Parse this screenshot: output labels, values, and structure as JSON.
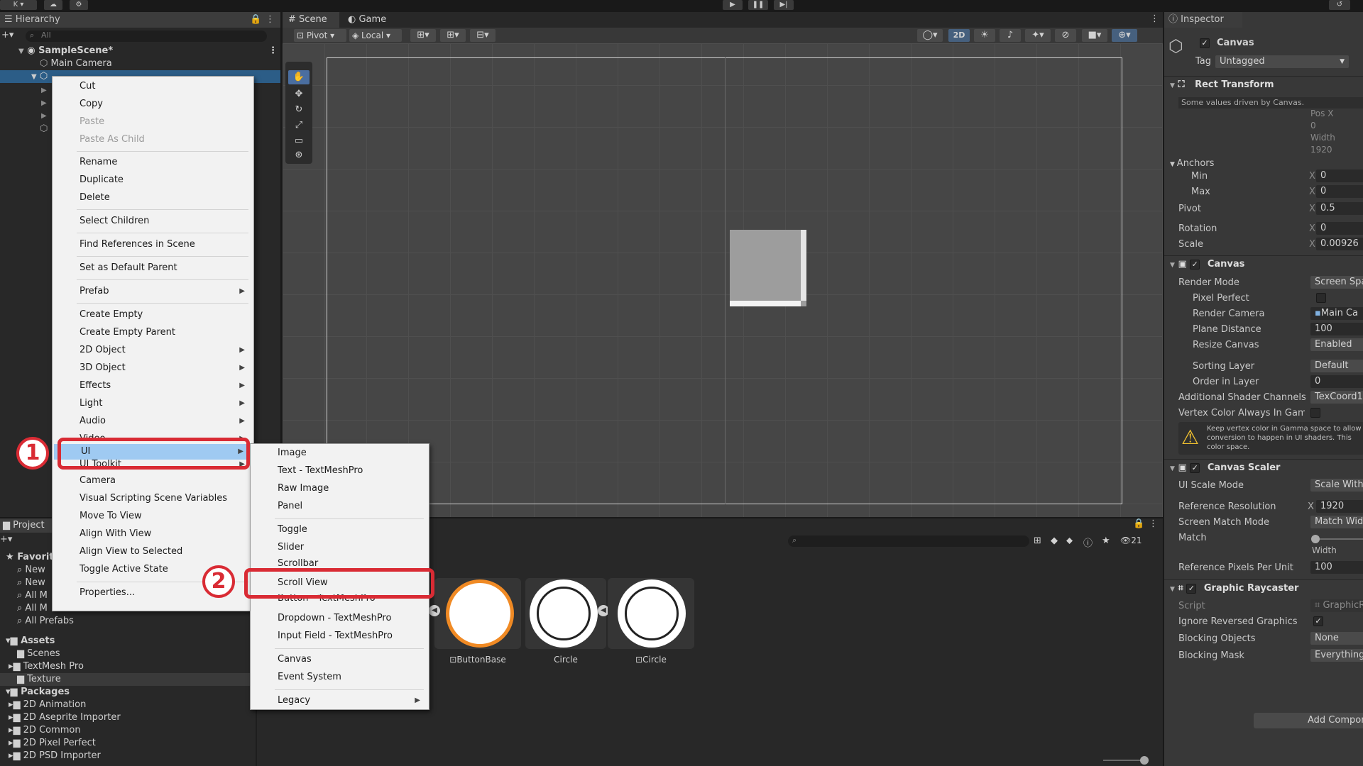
{
  "toolbar": {
    "account_label": "K"
  },
  "hierarchy": {
    "tab_label": "Hierarchy",
    "search_placeholder": "All",
    "scene_name": "SampleScene*",
    "items": [
      "Main Camera"
    ]
  },
  "scene_tabs": {
    "scene": "Scene",
    "game": "Game",
    "pivot": "Pivot",
    "local": "Local",
    "mode_2d": "2D"
  },
  "context_menu": {
    "items": [
      {
        "label": "Cut",
        "enabled": true
      },
      {
        "label": "Copy",
        "enabled": true
      },
      {
        "label": "Paste",
        "enabled": false
      },
      {
        "label": "Paste As Child",
        "enabled": false
      },
      {
        "label": "Rename",
        "enabled": true
      },
      {
        "label": "Duplicate",
        "enabled": true
      },
      {
        "label": "Delete",
        "enabled": true
      },
      {
        "label": "Select Children",
        "enabled": true
      },
      {
        "label": "Find References in Scene",
        "enabled": true
      },
      {
        "label": "Set as Default Parent",
        "enabled": true
      },
      {
        "label": "Prefab",
        "enabled": true
      },
      {
        "label": "Create Empty",
        "enabled": true
      },
      {
        "label": "Create Empty Parent",
        "enabled": true
      },
      {
        "label": "2D Object",
        "enabled": true
      },
      {
        "label": "3D Object",
        "enabled": true
      },
      {
        "label": "Effects",
        "enabled": true
      },
      {
        "label": "Light",
        "enabled": true
      },
      {
        "label": "Audio",
        "enabled": true
      },
      {
        "label": "Video",
        "enabled": true
      },
      {
        "label": "UI",
        "enabled": true
      },
      {
        "label": "UI Toolkit",
        "enabled": true
      },
      {
        "label": "Camera",
        "enabled": true
      },
      {
        "label": "Visual Scripting Scene Variables",
        "enabled": true
      },
      {
        "label": "Move To View",
        "enabled": true
      },
      {
        "label": "Align With View",
        "enabled": true
      },
      {
        "label": "Align View to Selected",
        "enabled": true
      },
      {
        "label": "Toggle Active State",
        "enabled": true
      },
      {
        "label": "Properties...",
        "enabled": true
      }
    ]
  },
  "ui_submenu": {
    "items": [
      "Image",
      "Text - TextMeshPro",
      "Raw Image",
      "Panel",
      "Toggle",
      "Slider",
      "Scrollbar",
      "Scroll View",
      "Button - TextMeshPro",
      "Dropdown - TextMeshPro",
      "Input Field - TextMeshPro",
      "Canvas",
      "Event System",
      "Legacy"
    ]
  },
  "annotations": {
    "step1": "1",
    "step2": "2"
  },
  "project": {
    "tab_label": "Project",
    "favorites_label": "Favorites",
    "favorites": [
      "New",
      "New",
      "All M",
      "All M",
      "All Prefabs"
    ],
    "assets_label": "Assets",
    "assets": [
      "Scenes",
      "TextMesh Pro",
      "Texture"
    ],
    "packages_label": "Packages",
    "packages": [
      "2D Animation",
      "2D Aseprite Importer",
      "2D Common",
      "2D Pixel Perfect",
      "2D PSD Importer"
    ],
    "item_count": "21",
    "thumbnails": [
      "ButtonBase",
      "Circle",
      "Circle"
    ]
  },
  "inspector": {
    "tab_label": "Inspector",
    "object_name": "Canvas",
    "tag_label": "Tag",
    "tag_value": "Untagged",
    "rect_transform": {
      "title": "Rect Transform",
      "note": "Some values driven by Canvas.",
      "pos_x_label": "Pos X",
      "pos_x": "0",
      "width_label": "Width",
      "width": "1920",
      "anchors_label": "Anchors",
      "min_label": "Min",
      "min_x": "0",
      "max_label": "Max",
      "max_x": "0",
      "pivot_label": "Pivot",
      "pivot_x": "0.5",
      "rotation_label": "Rotation",
      "rotation_x": "0",
      "scale_label": "Scale",
      "scale_x": "0.00926",
      "x_axis": "X"
    },
    "canvas": {
      "title": "Canvas",
      "rows": [
        {
          "label": "Render Mode",
          "value": "Screen Spa"
        },
        {
          "label": "Pixel Perfect",
          "value": ""
        },
        {
          "label": "Render Camera",
          "value": "Main Ca"
        },
        {
          "label": "Plane Distance",
          "value": "100"
        },
        {
          "label": "Resize Canvas",
          "value": "Enabled"
        },
        {
          "label": "Sorting Layer",
          "value": "Default"
        },
        {
          "label": "Order in Layer",
          "value": "0"
        },
        {
          "label": "Additional Shader Channels",
          "value": "TexCoord1,"
        },
        {
          "label": "Vertex Color Always In Gamm",
          "value": ""
        }
      ],
      "warning": "Keep vertex color in Gamma space to allow conversion to happen in UI shaders. This color space."
    },
    "canvas_scaler": {
      "title": "Canvas Scaler",
      "ui_scale_mode_label": "UI Scale Mode",
      "ui_scale_mode": "Scale With",
      "ref_res_label": "Reference Resolution",
      "ref_res_x": "1920",
      "match_mode_label": "Screen Match Mode",
      "match_mode": "Match Widt",
      "match_label": "Match",
      "match_width": "Width",
      "ppu_label": "Reference Pixels Per Unit",
      "ppu": "100"
    },
    "graphic_raycaster": {
      "title": "Graphic Raycaster",
      "script_label": "Script",
      "script": "GraphicR",
      "ignore_label": "Ignore Reversed Graphics",
      "blocking_objects_label": "Blocking Objects",
      "blocking_objects": "None",
      "blocking_mask_label": "Blocking Mask",
      "blocking_mask": "Everything"
    },
    "add_component": "Add Compon"
  }
}
